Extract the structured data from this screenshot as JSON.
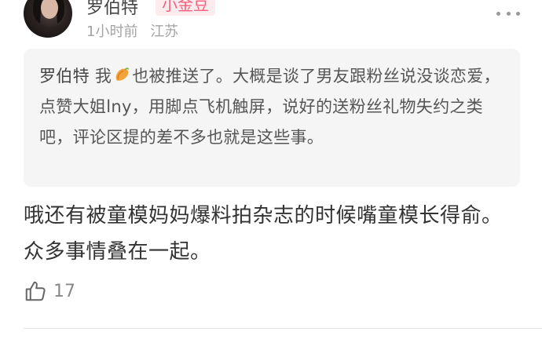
{
  "post": {
    "author": {
      "name": "罗伯特",
      "badge": "小金豆"
    },
    "meta": {
      "time": "1小时前",
      "location": "江苏"
    },
    "quote": {
      "mention": "罗伯特",
      "text_before_emoji": "我",
      "emoji": "sweet-potato-icon",
      "text_after_emoji": "也被推送了。大概是谈了男友跟粉丝说没谈恋爱，点赞大姐lny，用脚点飞机触屏，说好的送粉丝礼物失约之类吧，评论区提的差不多也就是这些事。"
    },
    "body": "哦还有被童模妈妈爆料拍杂志的时候嘴童模长得俞。众多事情叠在一起。",
    "likes": "17"
  },
  "icons": {
    "more": "more-dots-icon",
    "like": "thumbs-up-icon"
  },
  "colors": {
    "badge_text": "#f3617c",
    "badge_bg": "#fdecee",
    "quote_bg": "#f5f5f5"
  }
}
